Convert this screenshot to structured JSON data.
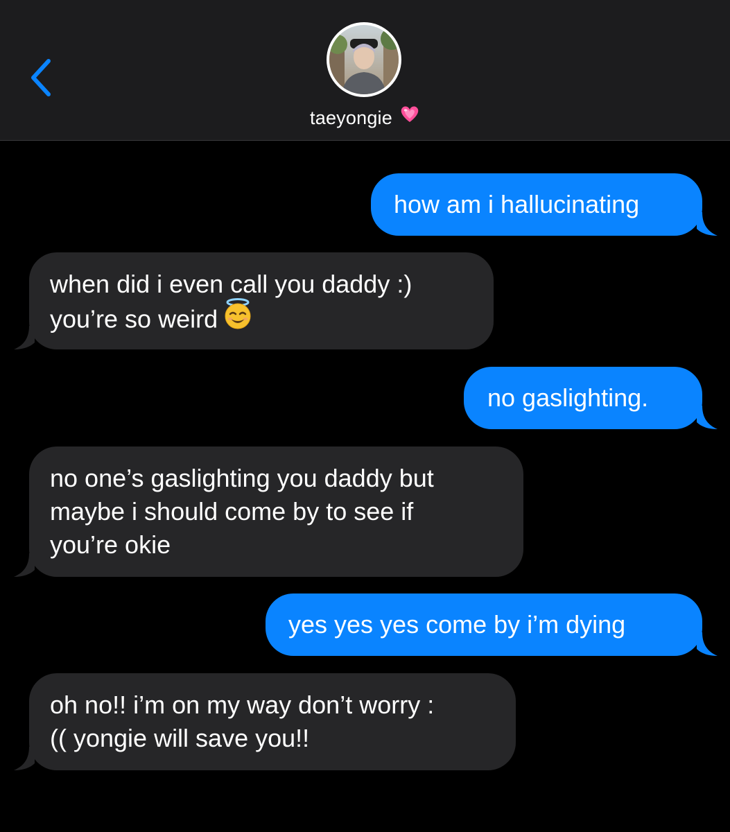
{
  "header": {
    "contact_name": "taeyongie",
    "back_icon": "chevron-left-icon",
    "heart_emoji": "💗",
    "accent_color": "#0a84ff"
  },
  "messages": [
    {
      "direction": "sent",
      "text": "how am i hallucinating"
    },
    {
      "direction": "received",
      "line1": "when did i even call you daddy :)",
      "line2": "you’re so weird",
      "emoji": "😇"
    },
    {
      "direction": "sent",
      "text": "no gaslighting."
    },
    {
      "direction": "received",
      "line1": "no one’s gaslighting you daddy but",
      "line2": "maybe i should come by to see if",
      "line3": "you’re okie"
    },
    {
      "direction": "sent",
      "text": "yes yes yes come by i’m dying"
    },
    {
      "direction": "received",
      "line1": "oh no!! i’m on my way don’t worry :",
      "line2": "(( yongie will save you!!"
    }
  ],
  "colors": {
    "sent_bubble": "#0a84ff",
    "received_bubble": "#262628",
    "header_bg": "#1c1c1e",
    "background": "#000000"
  }
}
